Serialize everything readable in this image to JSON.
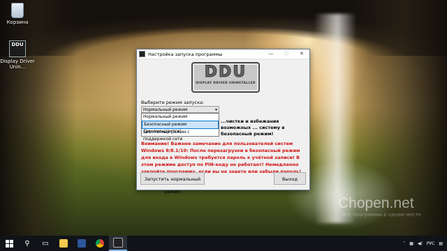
{
  "desktop": {
    "icons": [
      {
        "label": "Корзина"
      },
      {
        "label": "Display Driver Unin...",
        "logo_text": "DDU"
      }
    ],
    "watermark": "Chopen.net",
    "watermark_sub": "Все программы в одном месте"
  },
  "window": {
    "title": "Настройка запуска программы",
    "controls": {
      "minimize": "—",
      "maximize": "☐",
      "close": "✕"
    },
    "logo": {
      "main": "DDU",
      "sub": "DISPLAY DRIVER UNINSTALLER"
    },
    "select_label": "Выберите режим запуска:",
    "combo_value": "Нормальный режим",
    "options": [
      "Нормальный режим",
      "Безопасный режим (рекомендуется)",
      "Безопасный режим с поддержкой сети"
    ],
    "selected_option_index": 1,
    "info_text": "...чистки и избежания возможных ... систему в безопасный режим!",
    "warning": "Внимание! Важное замечание для пользователей систем Windows 8/8.1/10: После перезагрузки в безопасный режим для входа в Windows требуется пароль к учётной записи! В этом режиме доступ по PIN-коду не работает! Немедленно закройте программу, если вы не знаете или забыли пароль!",
    "start_button": "Запустить нормальный режим",
    "exit_button": "Выход"
  },
  "taskbar": {
    "apps": [
      "search-icon",
      "task-view-icon",
      "file-explorer-icon",
      "word-icon",
      "chrome-icon",
      "ddu-app-icon"
    ],
    "tray": {
      "language": "РУС"
    }
  },
  "colors": {
    "warning": "#d01010",
    "selection": "#cce4f7",
    "selection_border": "#0078d7"
  }
}
